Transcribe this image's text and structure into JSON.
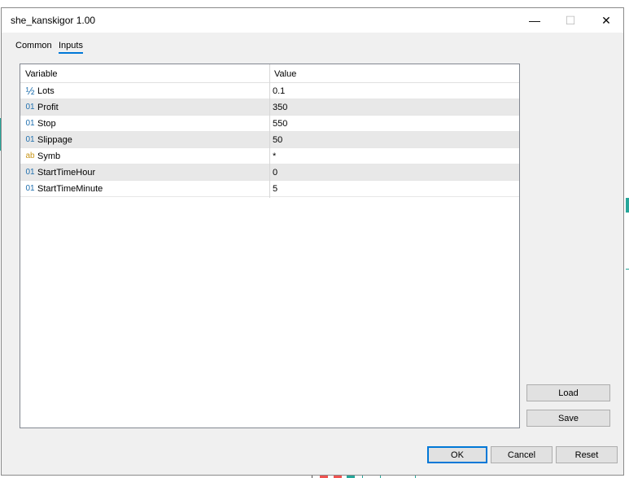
{
  "window": {
    "title": "she_kanskigor 1.00",
    "minimize_glyph": "—",
    "maximize_glyph": "☐",
    "close_glyph": "✕"
  },
  "tabs": [
    {
      "label": "Common",
      "active": false
    },
    {
      "label": "Inputs",
      "active": true
    }
  ],
  "table": {
    "columns": [
      "Variable",
      "Value"
    ],
    "rows": [
      {
        "type_icon": "½",
        "icon_name": "fraction-icon",
        "icon_color": "#1f6fae",
        "variable": "Lots",
        "value": "0.1"
      },
      {
        "type_icon": "01",
        "icon_name": "integer-icon",
        "icon_color": "#1f6fae",
        "variable": "Profit",
        "value": "350"
      },
      {
        "type_icon": "01",
        "icon_name": "integer-icon",
        "icon_color": "#1f6fae",
        "variable": "Stop",
        "value": "550"
      },
      {
        "type_icon": "01",
        "icon_name": "integer-icon",
        "icon_color": "#1f6fae",
        "variable": "Slippage",
        "value": "50"
      },
      {
        "type_icon": "ab",
        "icon_name": "string-icon",
        "icon_color": "#c8961a",
        "variable": "Symb",
        "value": "*"
      },
      {
        "type_icon": "01",
        "icon_name": "integer-icon",
        "icon_color": "#1f6fae",
        "variable": "StartTimeHour",
        "value": "0"
      },
      {
        "type_icon": "01",
        "icon_name": "integer-icon",
        "icon_color": "#1f6fae",
        "variable": "StartTimeMinute",
        "value": "5"
      }
    ]
  },
  "side_buttons": {
    "load": "Load",
    "save": "Save"
  },
  "bottom_buttons": {
    "ok": "OK",
    "cancel": "Cancel",
    "reset": "Reset"
  },
  "colors": {
    "accent": "#0078d7",
    "chart_green": "#26a69a",
    "chart_red": "#ef5350"
  }
}
